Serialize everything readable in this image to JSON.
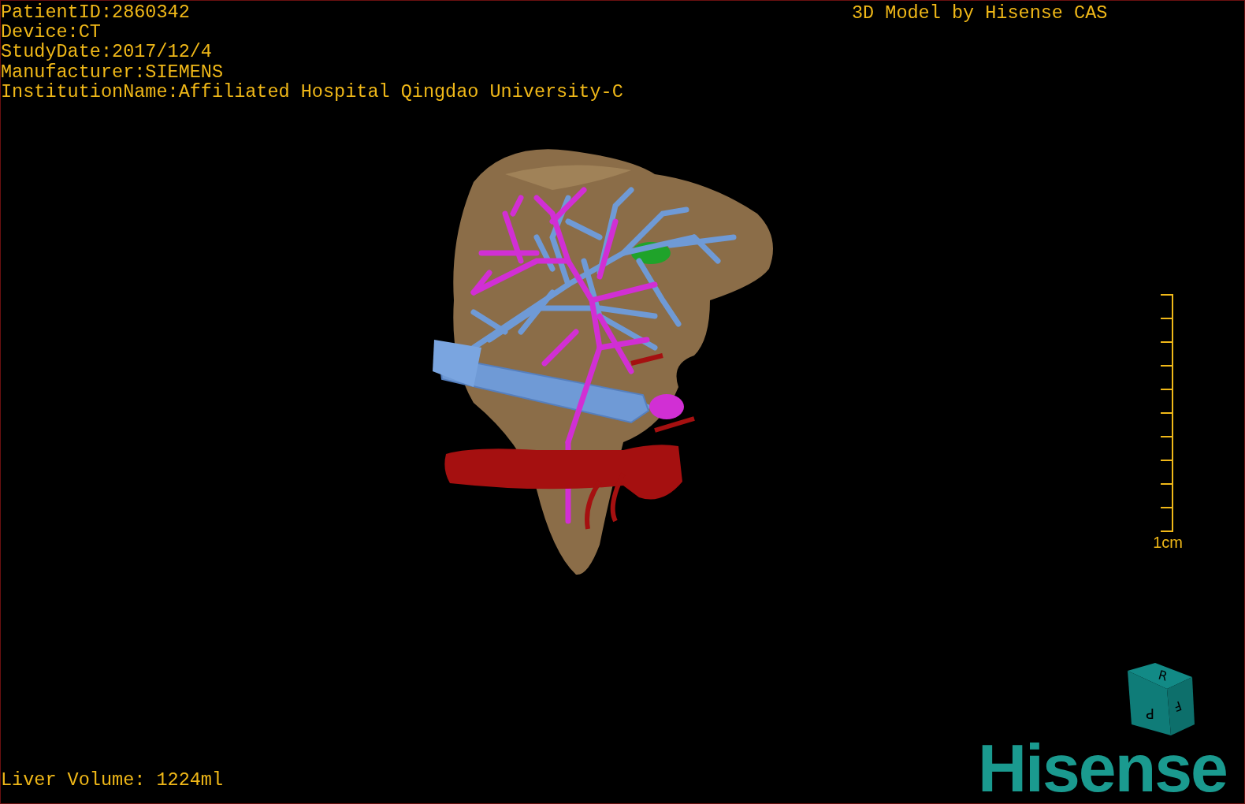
{
  "patient_info": [
    "PatientID:2860342",
    "Device:CT",
    "StudyDate:2017/12/4",
    "Manufacturer:SIEMENS",
    "InstitutionName:Affiliated Hospital Qingdao University-C"
  ],
  "model_caption": "3D Model by Hisense CAS",
  "scale_bar": {
    "label": "1cm"
  },
  "orientation_cube": {
    "faces": [
      "R",
      "F",
      "P"
    ]
  },
  "logo": "Hisense",
  "liver_volume": "Liver Volume: 1224ml"
}
